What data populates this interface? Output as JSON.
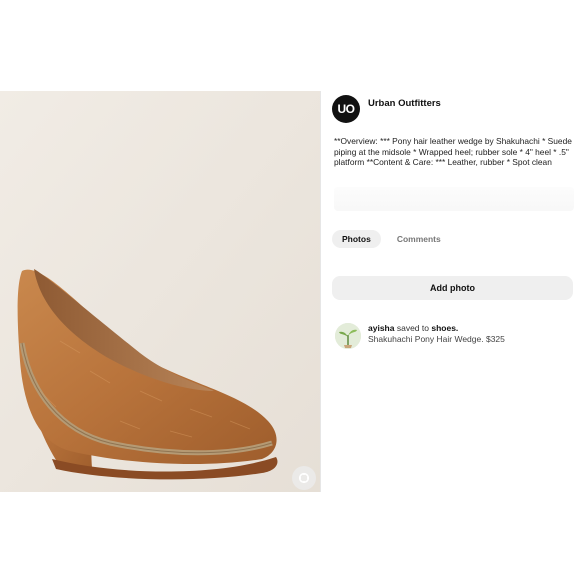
{
  "brand": {
    "avatar_text": "UO",
    "name": "Urban Outfitters"
  },
  "description": "**Overview:  *** Pony hair leather wedge by Shakuhachi  * Suede piping at the midsole  * Wrapped heel; rubber sole  * 4\" heel  * .5\" platform    **Content & Care:  *** Leather, rubber  * Spot clean",
  "tabs": [
    {
      "label": "Photos",
      "active": true
    },
    {
      "label": "Comments",
      "active": false
    }
  ],
  "add_photo_label": "Add photo",
  "save": {
    "user": "ayisha",
    "action": "saved to",
    "board": "shoes.",
    "pin_title": "Shakuhachi Pony Hair Wedge. $325"
  },
  "icons": {
    "zoom": "expand-icon",
    "saver_avatar": "plant-thumbnail"
  },
  "colors": {
    "accent": "#111111",
    "button_bg": "#efefef",
    "shoe": "#b9773f"
  }
}
